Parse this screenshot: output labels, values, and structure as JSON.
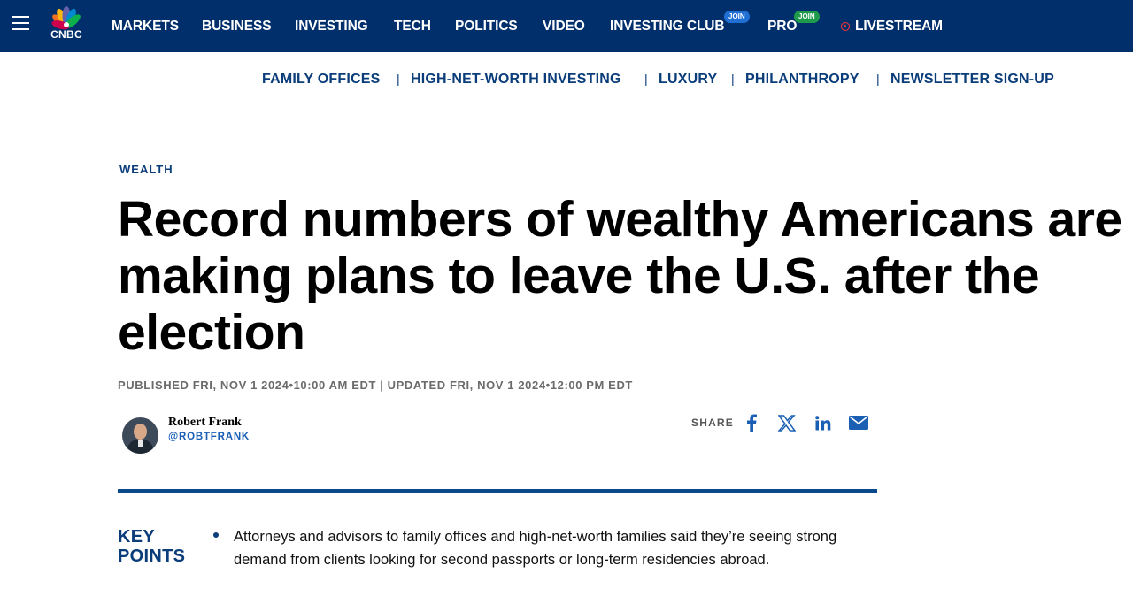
{
  "brand": {
    "logo_text": "CNBC"
  },
  "topnav": {
    "items": [
      {
        "label": "MARKETS"
      },
      {
        "label": "BUSINESS"
      },
      {
        "label": "INVESTING"
      },
      {
        "label": "TECH"
      },
      {
        "label": "POLITICS"
      },
      {
        "label": "VIDEO"
      },
      {
        "label": "INVESTING CLUB",
        "badge": "JOIN"
      },
      {
        "label": "PRO",
        "badge": "JOIN"
      },
      {
        "label": "LIVESTREAM"
      }
    ]
  },
  "subnav": {
    "items": [
      {
        "label": "FAMILY OFFICES"
      },
      {
        "label": "HIGH-NET-WORTH INVESTING"
      },
      {
        "label": "LUXURY"
      },
      {
        "label": "PHILANTHROPY"
      },
      {
        "label": "NEWSLETTER SIGN-UP"
      }
    ],
    "separator": "|"
  },
  "article": {
    "kicker": "WEALTH",
    "headline": "Record numbers of wealthy Americans are making plans to leave the U.S. after the election",
    "timestamps": "PUBLISHED FRI, NOV 1 2024•10:00 AM EDT | UPDATED FRI, NOV 1 2024•12:00 PM EDT",
    "author": {
      "name": "Robert Frank",
      "handle": "@ROBTFRANK"
    },
    "share_label": "SHARE",
    "share_icons": [
      "facebook-icon",
      "x-icon",
      "linkedin-icon",
      "email-icon"
    ],
    "key_points": {
      "label": "KEY POINTS",
      "items": [
        "Attorneys and advisors to family offices and high-net-worth families said they’re seeing strong demand from clients looking for second passports or long-term residencies abroad."
      ]
    }
  },
  "colors": {
    "nav_bg": "#002f6c",
    "link_blue": "#0a3d7a",
    "rule_blue": "#0a4a8c",
    "live_red": "#ff3333",
    "badge_blue": "#1f6fd4",
    "badge_green": "#1d9a4a"
  }
}
